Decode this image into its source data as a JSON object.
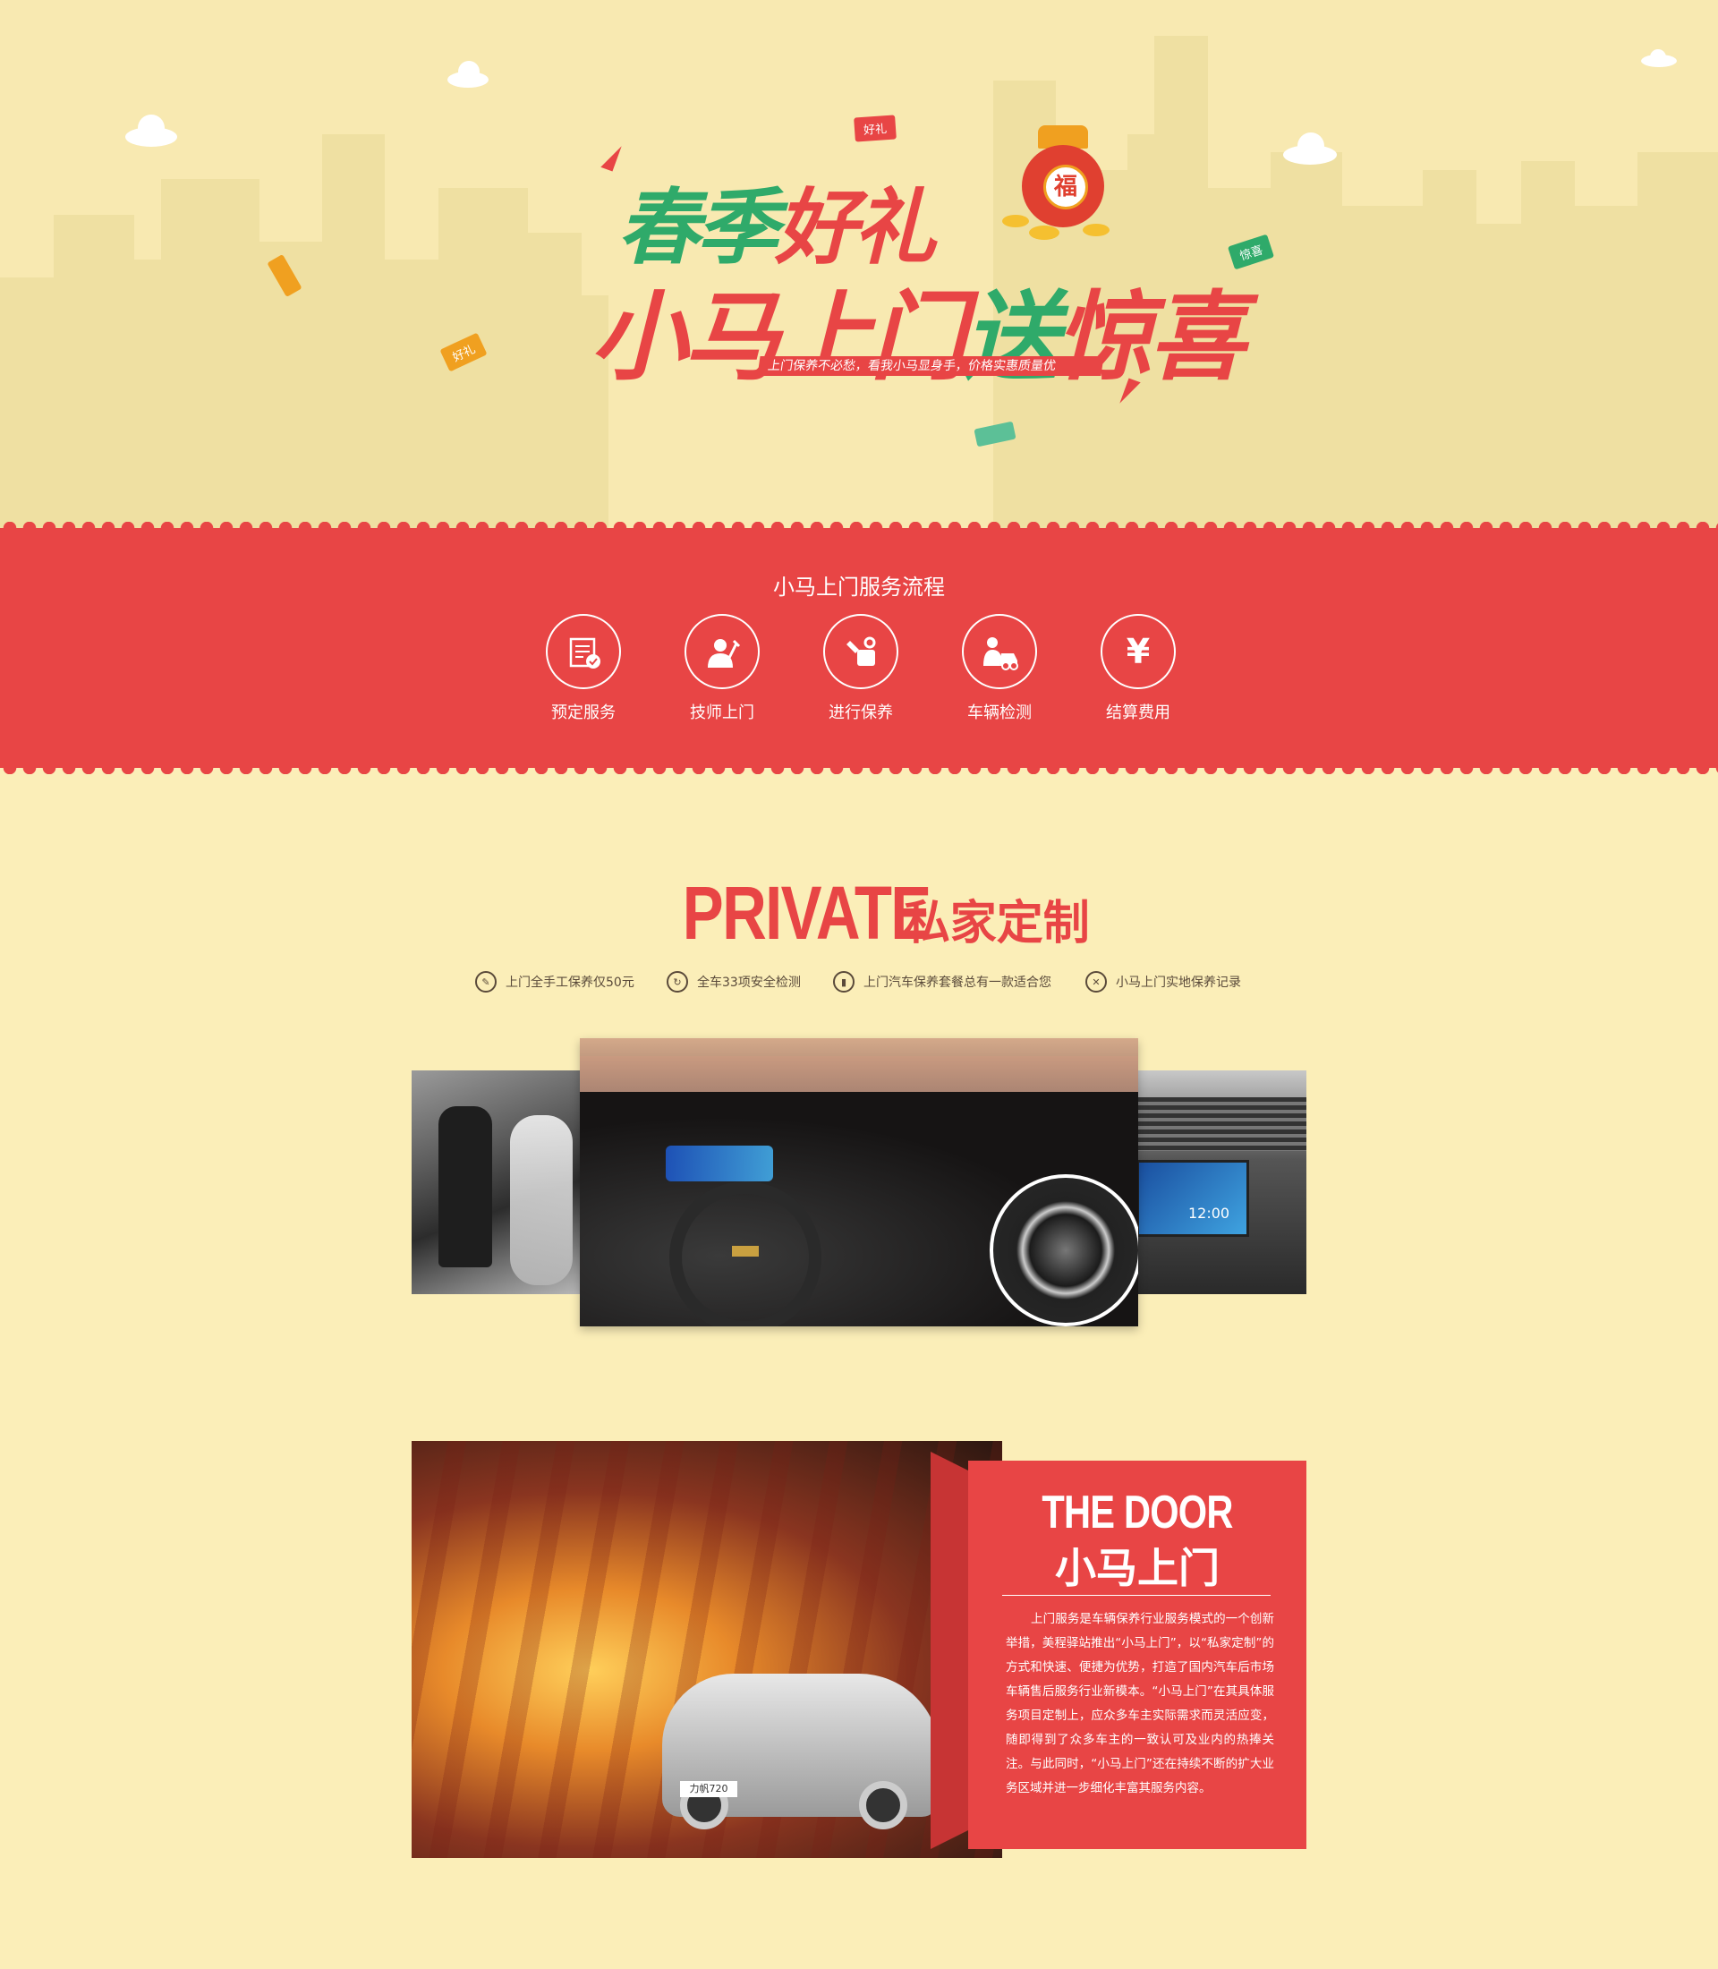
{
  "hero": {
    "title_line1_a": "春季",
    "title_line1_b": "好礼",
    "title_line2_a": "小马上门",
    "title_line2_b": "送",
    "title_line2_c": "惊喜",
    "subtitle": "上门保养不必愁，看我小马显身手，价格实惠质量优",
    "bag_char": "福",
    "tag_gift": "好礼",
    "tag_surprise": "惊喜"
  },
  "service_flow": {
    "title": "小马上门服务流程",
    "steps": [
      {
        "label": "预定服务",
        "icon": "booking-icon"
      },
      {
        "label": "技师上门",
        "icon": "technician-icon"
      },
      {
        "label": "进行保养",
        "icon": "maintenance-icon"
      },
      {
        "label": "车辆检测",
        "icon": "inspection-icon"
      },
      {
        "label": "结算费用",
        "icon": "yen-icon"
      }
    ],
    "yen_symbol": "¥"
  },
  "private": {
    "heading_en": "PRIVATE",
    "heading_cn": "私家定制",
    "features": [
      {
        "label": "上门全手工保养仅50元",
        "icon": "brush-icon"
      },
      {
        "label": "全车33项安全检测",
        "icon": "refresh-icon"
      },
      {
        "label": "上门汽车保养套餐总有一款适合您",
        "icon": "oil-can-icon"
      },
      {
        "label": "小马上门实地保养记录",
        "icon": "tools-icon"
      }
    ]
  },
  "gallery": {
    "screen_time": "12:00"
  },
  "door": {
    "heading_en": "THE DOOR",
    "heading_cn": "小马上门",
    "body": "上门服务是车辆保养行业服务模式的一个创新举措，美程驿站推出“小马上门”，以“私家定制”的方式和快速、便捷为优势，打造了国内汽车后市场车辆售后服务行业新模本。“小马上门”在其具体服务项目定制上，应众多车主实际需求而灵活应变，随即得到了众多车主的一致认可及业内的热捧关注。与此同时，“小马上门”还在持续不断的扩大业务区域并进一步细化丰富其服务内容。",
    "car_badge": "力帆720"
  },
  "colors": {
    "background": "#fbeeb8",
    "accent_red": "#e84545",
    "accent_green": "#2faa6a",
    "skyline": "#efe0a2"
  }
}
